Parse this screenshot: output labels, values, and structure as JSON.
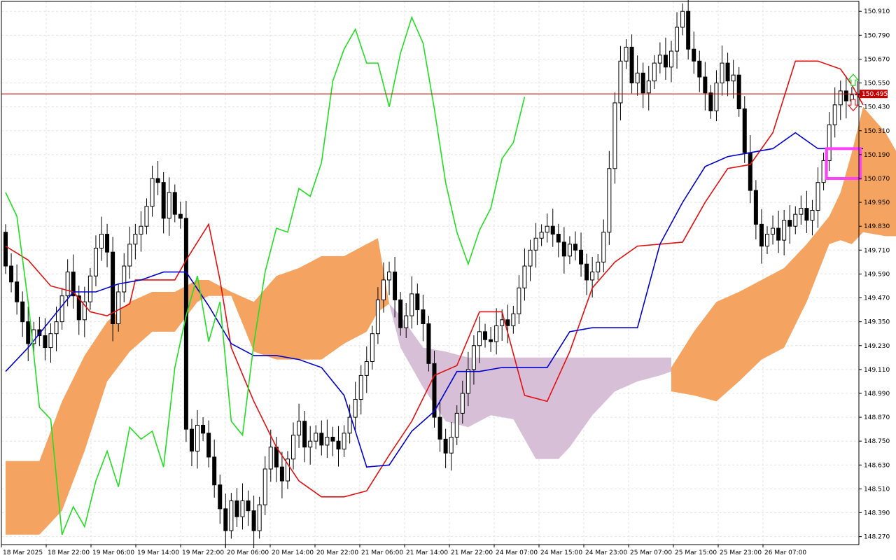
{
  "chart_data": {
    "type": "candlestick",
    "symbol_timeframe": "",
    "y_ticks": [
      "150.910",
      "150.790",
      "150.670",
      "150.550",
      "150.430",
      "150.310",
      "150.190",
      "150.070",
      "149.950",
      "149.830",
      "149.710",
      "149.590",
      "149.470",
      "149.350",
      "149.230",
      "149.110",
      "148.990",
      "148.870",
      "148.750",
      "148.630",
      "148.510",
      "148.390",
      "148.270"
    ],
    "x_ticks": [
      "18 Mar 2025",
      "18 Mar 22:00",
      "19 Mar 06:00",
      "19 Mar 14:00",
      "19 Mar 22:00",
      "20 Mar 06:00",
      "20 Mar 14:00",
      "20 Mar 22:00",
      "21 Mar 06:00",
      "21 Mar 14:00",
      "21 Mar 22:00",
      "24 Mar 07:00",
      "24 Mar 15:00",
      "24 Mar 23:00",
      "25 Mar 07:00",
      "25 Mar 15:00",
      "25 Mar 23:00",
      "26 Mar 07:00"
    ],
    "ylim": [
      148.23,
      150.96
    ],
    "grid": true,
    "current_price": "150.495",
    "bars": 152,
    "candles": [
      [
        149.8,
        149.63
      ],
      [
        149.63,
        149.55
      ],
      [
        149.55,
        149.45
      ],
      [
        149.45,
        149.35
      ],
      [
        149.35,
        149.24
      ],
      [
        149.24,
        149.31
      ],
      [
        149.31,
        149.28
      ],
      [
        149.28,
        149.22
      ],
      [
        149.22,
        149.29
      ],
      [
        149.29,
        149.35
      ],
      [
        149.35,
        149.48
      ],
      [
        149.48,
        149.6
      ],
      [
        149.6,
        149.48
      ],
      [
        149.48,
        149.36
      ],
      [
        149.36,
        149.45
      ],
      [
        149.45,
        149.58
      ],
      [
        149.58,
        149.72
      ],
      [
        149.72,
        149.79
      ],
      [
        149.79,
        149.7
      ],
      [
        149.7,
        149.34
      ],
      [
        149.34,
        149.5
      ],
      [
        149.5,
        149.63
      ],
      [
        149.63,
        149.74
      ],
      [
        149.74,
        149.79
      ],
      [
        149.79,
        149.83
      ],
      [
        149.83,
        149.93
      ],
      [
        149.93,
        150.07
      ],
      [
        150.07,
        150.05
      ],
      [
        150.05,
        149.87
      ],
      [
        149.87,
        150.0
      ],
      [
        150.0,
        149.89
      ],
      [
        149.89,
        149.87
      ],
      [
        149.87,
        148.81
      ],
      [
        148.81,
        148.7
      ],
      [
        148.7,
        148.83
      ],
      [
        148.83,
        148.79
      ],
      [
        148.79,
        148.67
      ],
      [
        148.67,
        148.53
      ],
      [
        148.53,
        148.41
      ],
      [
        148.41,
        148.3
      ],
      [
        148.3,
        148.45
      ],
      [
        148.45,
        148.37
      ],
      [
        148.37,
        148.45
      ],
      [
        148.45,
        148.4
      ],
      [
        148.4,
        148.3
      ],
      [
        148.3,
        148.43
      ],
      [
        148.43,
        148.61
      ],
      [
        148.61,
        148.72
      ],
      [
        148.72,
        148.62
      ],
      [
        148.62,
        148.55
      ],
      [
        148.55,
        148.66
      ],
      [
        148.66,
        148.78
      ],
      [
        148.78,
        148.85
      ],
      [
        148.85,
        148.72
      ],
      [
        148.72,
        148.75
      ],
      [
        148.75,
        148.79
      ],
      [
        148.79,
        148.73
      ],
      [
        148.73,
        148.77
      ],
      [
        148.77,
        148.75
      ],
      [
        148.75,
        148.71
      ],
      [
        148.71,
        148.79
      ],
      [
        148.79,
        148.87
      ],
      [
        148.87,
        148.96
      ],
      [
        148.96,
        149.08
      ],
      [
        149.08,
        149.15
      ],
      [
        149.15,
        149.29
      ],
      [
        149.29,
        149.46
      ],
      [
        149.46,
        149.56
      ],
      [
        149.56,
        149.6
      ],
      [
        149.6,
        149.46
      ],
      [
        149.46,
        149.32
      ],
      [
        149.32,
        149.38
      ],
      [
        149.38,
        149.49
      ],
      [
        149.49,
        149.41
      ],
      [
        149.41,
        149.34
      ],
      [
        149.34,
        149.14
      ],
      [
        149.14,
        148.87
      ],
      [
        148.87,
        148.76
      ],
      [
        148.76,
        148.69
      ],
      [
        148.69,
        148.77
      ],
      [
        148.77,
        148.89
      ],
      [
        148.89,
        148.99
      ],
      [
        148.99,
        149.11
      ],
      [
        149.11,
        149.23
      ],
      [
        149.23,
        149.3
      ],
      [
        149.3,
        149.26
      ],
      [
        149.26,
        149.25
      ],
      [
        149.25,
        149.33
      ],
      [
        149.33,
        149.36
      ],
      [
        149.36,
        149.33
      ],
      [
        149.33,
        149.39
      ],
      [
        149.39,
        149.52
      ],
      [
        149.52,
        149.63
      ],
      [
        149.63,
        149.71
      ],
      [
        149.71,
        149.77
      ],
      [
        149.77,
        149.8
      ],
      [
        149.8,
        149.83
      ],
      [
        149.83,
        149.79
      ],
      [
        149.79,
        149.75
      ],
      [
        149.75,
        149.68
      ],
      [
        149.68,
        149.74
      ],
      [
        149.74,
        149.71
      ],
      [
        149.71,
        149.64
      ],
      [
        149.64,
        149.56
      ],
      [
        149.56,
        149.6
      ],
      [
        149.6,
        149.65
      ],
      [
        149.65,
        149.8
      ],
      [
        149.8,
        150.12
      ],
      [
        150.12,
        150.45
      ],
      [
        150.45,
        150.66
      ],
      [
        150.66,
        150.73
      ],
      [
        150.73,
        150.55
      ],
      [
        150.55,
        150.6
      ],
      [
        150.6,
        150.5
      ],
      [
        150.5,
        150.56
      ],
      [
        150.56,
        150.65
      ],
      [
        150.65,
        150.69
      ],
      [
        150.69,
        150.63
      ],
      [
        150.63,
        150.71
      ],
      [
        150.71,
        150.83
      ],
      [
        150.83,
        150.91
      ],
      [
        150.91,
        150.72
      ],
      [
        150.72,
        150.66
      ],
      [
        150.66,
        150.58
      ],
      [
        150.58,
        150.5
      ],
      [
        150.5,
        150.41
      ],
      [
        150.41,
        150.55
      ],
      [
        150.55,
        150.65
      ],
      [
        150.65,
        150.56
      ],
      [
        150.56,
        150.59
      ],
      [
        150.59,
        150.42
      ],
      [
        150.42,
        150.2
      ],
      [
        150.2,
        150.01
      ],
      [
        150.01,
        149.84
      ],
      [
        149.84,
        149.73
      ],
      [
        149.73,
        149.79
      ],
      [
        149.79,
        149.82
      ],
      [
        149.82,
        149.76
      ],
      [
        149.76,
        149.86
      ],
      [
        149.86,
        149.83
      ],
      [
        149.83,
        149.89
      ],
      [
        149.89,
        149.92
      ],
      [
        149.92,
        149.86
      ],
      [
        149.86,
        149.91
      ],
      [
        149.91,
        150.05
      ],
      [
        150.05,
        150.16
      ],
      [
        150.16,
        150.34
      ],
      [
        150.34,
        150.44
      ],
      [
        150.44,
        150.51
      ],
      [
        150.51,
        150.46
      ],
      [
        150.46,
        150.49
      ],
      [
        150.49,
        150.495
      ]
    ],
    "series": [
      {
        "color": "#e01010",
        "key": "tenkan",
        "points": [
          [
            0,
            149.73
          ],
          [
            4,
            149.66
          ],
          [
            8,
            149.53
          ],
          [
            12,
            149.5
          ],
          [
            15,
            149.4
          ],
          [
            18,
            149.38
          ],
          [
            22,
            149.44
          ],
          [
            23,
            149.56
          ],
          [
            26,
            149.56
          ],
          [
            30,
            149.56
          ],
          [
            32,
            149.66
          ],
          [
            36,
            149.84
          ],
          [
            38,
            149.56
          ],
          [
            40,
            149.22
          ],
          [
            44,
            148.95
          ],
          [
            48,
            148.72
          ],
          [
            52,
            148.55
          ],
          [
            56,
            148.47
          ],
          [
            60,
            148.47
          ],
          [
            64,
            148.5
          ],
          [
            68,
            148.68
          ],
          [
            72,
            148.85
          ],
          [
            76,
            149.08
          ],
          [
            80,
            149.13
          ],
          [
            84,
            149.4
          ],
          [
            88,
            149.4
          ],
          [
            92,
            148.98
          ],
          [
            96,
            148.95
          ],
          [
            100,
            149.2
          ],
          [
            104,
            149.52
          ],
          [
            108,
            149.65
          ],
          [
            112,
            149.73
          ],
          [
            116,
            149.74
          ],
          [
            120,
            149.75
          ],
          [
            124,
            149.95
          ],
          [
            128,
            150.12
          ],
          [
            132,
            150.14
          ],
          [
            136,
            150.3
          ],
          [
            140,
            150.66
          ],
          [
            144,
            150.66
          ],
          [
            148,
            150.62
          ],
          [
            150,
            150.54
          ],
          [
            152,
            150.44
          ]
        ]
      },
      {
        "color": "#0000cc",
        "key": "kijun",
        "points": [
          [
            0,
            149.1
          ],
          [
            4,
            149.22
          ],
          [
            8,
            149.36
          ],
          [
            12,
            149.5
          ],
          [
            16,
            149.5
          ],
          [
            20,
            149.54
          ],
          [
            24,
            149.56
          ],
          [
            28,
            149.6
          ],
          [
            32,
            149.6
          ],
          [
            36,
            149.43
          ],
          [
            40,
            149.24
          ],
          [
            44,
            149.18
          ],
          [
            48,
            149.18
          ],
          [
            52,
            149.16
          ],
          [
            56,
            149.12
          ],
          [
            60,
            148.98
          ],
          [
            64,
            148.62
          ],
          [
            68,
            148.63
          ],
          [
            72,
            148.8
          ],
          [
            76,
            148.9
          ],
          [
            80,
            149.1
          ],
          [
            84,
            149.1
          ],
          [
            88,
            149.12
          ],
          [
            92,
            149.12
          ],
          [
            96,
            149.12
          ],
          [
            100,
            149.3
          ],
          [
            104,
            149.32
          ],
          [
            108,
            149.32
          ],
          [
            112,
            149.32
          ],
          [
            116,
            149.74
          ],
          [
            120,
            149.95
          ],
          [
            124,
            150.13
          ],
          [
            128,
            150.18
          ],
          [
            132,
            150.2
          ],
          [
            136,
            150.22
          ],
          [
            140,
            150.3
          ],
          [
            144,
            150.22
          ],
          [
            148,
            150.22
          ],
          [
            152,
            150.22
          ]
        ]
      },
      {
        "color": "#22dd22",
        "key": "chikou",
        "points": [
          [
            0,
            150.0
          ],
          [
            2,
            149.88
          ],
          [
            4,
            149.45
          ],
          [
            6,
            148.92
          ],
          [
            8,
            148.86
          ],
          [
            10,
            148.28
          ],
          [
            12,
            148.42
          ],
          [
            14,
            148.32
          ],
          [
            16,
            148.55
          ],
          [
            18,
            148.7
          ],
          [
            20,
            148.52
          ],
          [
            22,
            148.82
          ],
          [
            24,
            148.76
          ],
          [
            26,
            148.8
          ],
          [
            28,
            148.62
          ],
          [
            30,
            149.12
          ],
          [
            32,
            149.38
          ],
          [
            34,
            149.58
          ],
          [
            36,
            149.25
          ],
          [
            38,
            149.45
          ],
          [
            40,
            148.85
          ],
          [
            42,
            148.78
          ],
          [
            44,
            149.24
          ],
          [
            46,
            149.6
          ],
          [
            48,
            149.82
          ],
          [
            50,
            149.8
          ],
          [
            52,
            150.02
          ],
          [
            54,
            149.98
          ],
          [
            56,
            150.15
          ],
          [
            58,
            150.56
          ],
          [
            60,
            150.72
          ],
          [
            62,
            150.82
          ],
          [
            64,
            150.65
          ],
          [
            66,
            150.65
          ],
          [
            68,
            150.43
          ],
          [
            70,
            150.7
          ],
          [
            72,
            150.88
          ],
          [
            74,
            150.75
          ],
          [
            76,
            150.42
          ],
          [
            78,
            150.05
          ],
          [
            80,
            149.8
          ],
          [
            82,
            149.64
          ],
          [
            84,
            149.81
          ],
          [
            86,
            149.92
          ],
          [
            88,
            150.17
          ],
          [
            90,
            150.25
          ],
          [
            92,
            150.48
          ]
        ]
      },
      {
        "color": "#2d4f6e",
        "key": "hidden-kijun",
        "points": [
          [
            0,
            149.1
          ]
        ]
      }
    ],
    "cloud_orange": [
      [
        0,
        148.65,
        148.28
      ],
      [
        6,
        148.65,
        148.28
      ],
      [
        10,
        148.95,
        148.4
      ],
      [
        14,
        149.18,
        148.7
      ],
      [
        18,
        149.35,
        149.05
      ],
      [
        22,
        149.45,
        149.2
      ],
      [
        26,
        149.5,
        149.3
      ],
      [
        30,
        149.5,
        149.3
      ],
      [
        34,
        149.56,
        149.45
      ],
      [
        36,
        149.56,
        149.48
      ],
      [
        40,
        149.5,
        149.48
      ],
      [
        44,
        149.45,
        149.2
      ],
      [
        48,
        149.58,
        149.16
      ],
      [
        52,
        149.62,
        149.16
      ],
      [
        56,
        149.68,
        149.16
      ],
      [
        60,
        149.68,
        149.24
      ],
      [
        64,
        149.74,
        149.3
      ],
      [
        66,
        149.77,
        149.4
      ],
      [
        68,
        149.44,
        149.44
      ]
    ],
    "cloud_purple": [
      [
        68,
        149.44,
        149.44
      ],
      [
        70,
        149.38,
        149.22
      ],
      [
        74,
        149.22,
        149.02
      ],
      [
        78,
        149.2,
        148.85
      ],
      [
        82,
        149.17,
        148.82
      ],
      [
        86,
        149.17,
        148.88
      ],
      [
        90,
        149.17,
        148.86
      ],
      [
        94,
        149.17,
        148.66
      ],
      [
        98,
        149.17,
        148.66
      ],
      [
        100,
        149.17,
        148.72
      ],
      [
        104,
        149.17,
        148.88
      ],
      [
        108,
        149.17,
        149.0
      ],
      [
        112,
        149.17,
        149.05
      ],
      [
        116,
        149.17,
        149.08
      ],
      [
        118,
        149.17,
        149.1
      ]
    ],
    "cloud_orange2": [
      [
        118,
        149.12,
        149.0
      ],
      [
        122,
        149.3,
        148.98
      ],
      [
        126,
        149.45,
        148.95
      ],
      [
        130,
        149.5,
        149.05
      ],
      [
        134,
        149.56,
        149.16
      ],
      [
        138,
        149.62,
        149.22
      ],
      [
        142,
        149.74,
        149.45
      ],
      [
        146,
        149.88,
        149.74
      ],
      [
        148,
        150.0,
        149.76
      ],
      [
        150,
        150.2,
        149.74
      ],
      [
        152,
        150.43,
        149.8
      ],
      [
        156,
        150.3,
        149.78
      ],
      [
        160,
        150.1,
        149.78
      ],
      [
        164,
        150.0,
        149.82
      ]
    ],
    "signal_box": {
      "index_from": 146,
      "index_to": 151,
      "top": 150.22,
      "bottom": 150.07
    },
    "arrows": {
      "up": "up-arrow",
      "down": "down-arrow"
    }
  }
}
